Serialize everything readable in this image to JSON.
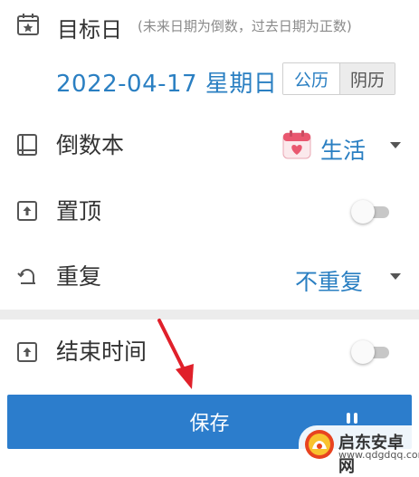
{
  "target_date": {
    "label": "目标日",
    "hint": "(未来日期为倒数，过去日期为正数)",
    "date": "2022-04-17",
    "weekday": "星期日",
    "calendar_solar": "公历",
    "calendar_lunar": "阴历",
    "selected_calendar": "公历"
  },
  "countdown_book": {
    "label": "倒数本",
    "value": "生活"
  },
  "pin_top": {
    "label": "置顶",
    "enabled": false
  },
  "repeat": {
    "label": "重复",
    "value": "不重复"
  },
  "end_time": {
    "label": "结束时间",
    "enabled": false
  },
  "save": {
    "label": "保存"
  },
  "watermark": {
    "name": "启东安卓网",
    "url": "www.qdgdqq.com"
  },
  "colors": {
    "accent": "#2a7fc2",
    "button": "#2c7dcc",
    "arrow": "#e0202a"
  }
}
